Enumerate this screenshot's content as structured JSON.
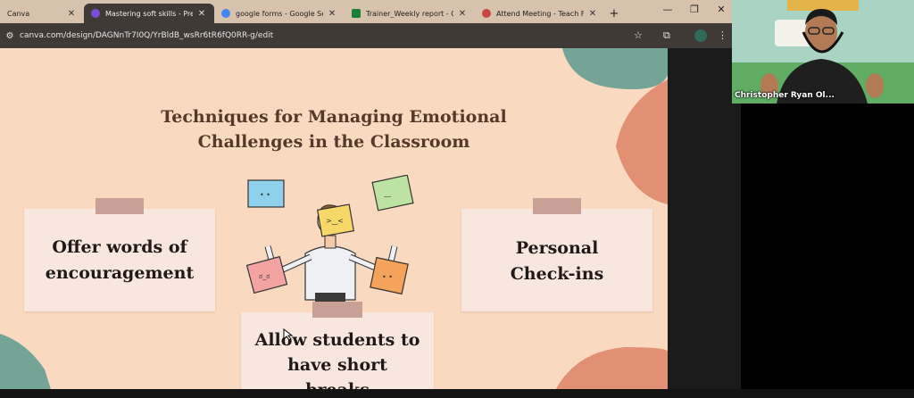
{
  "browser": {
    "tabs": [
      {
        "label": "Canva",
        "favicon_color": "#00c4cc",
        "active": false
      },
      {
        "label": "Mastering soft skills - Presen",
        "favicon_color": "#7d4cdb",
        "active": true
      },
      {
        "label": "google forms - Google Sear",
        "favicon_color": "#4285f4",
        "active": false
      },
      {
        "label": "Trainer_Weekly report - Goo",
        "favicon_color": "#188038",
        "active": false
      },
      {
        "label": "Attend Meeting - Teach For",
        "favicon_color": "#c44",
        "active": false
      }
    ],
    "close_glyph": "✕",
    "new_tab_glyph": "+",
    "url": "canva.com/design/DAGNnTr7I0Q/YrBldB_wsRr6tR6fQ0RR-g/edit",
    "window_controls": {
      "minimize": "—",
      "restore": "❐",
      "close": "✕"
    },
    "toolbar_glyphs": {
      "site_info": "⚙",
      "bookmark": "☆",
      "extensions": "⧉",
      "menu": "⋮"
    }
  },
  "slide": {
    "title_line1": "Techniques for Managing Emotional",
    "title_line2": "Challenges in the Classroom",
    "note_left_line1": "Offer words of",
    "note_left_line2": "encouragement",
    "note_right_line1": "Personal",
    "note_right_line2": "Check-ins",
    "note_bottom_line1": "Allow students to",
    "note_bottom_line2": "have short",
    "note_bottom_line3": "breaks",
    "colors": {
      "background": "#f9d9bf",
      "teal_blob": "#74a496",
      "orange_blob": "#e29074",
      "title": "#553a2b"
    }
  },
  "video": {
    "participant_name": "Christopher Ryan Ol..."
  }
}
